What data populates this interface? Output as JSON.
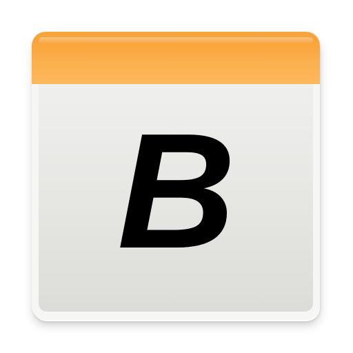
{
  "icon": {
    "letter": "B",
    "header_color": "#f9a33a",
    "body_color": "#e7e7e4",
    "letter_color": "#000000"
  }
}
